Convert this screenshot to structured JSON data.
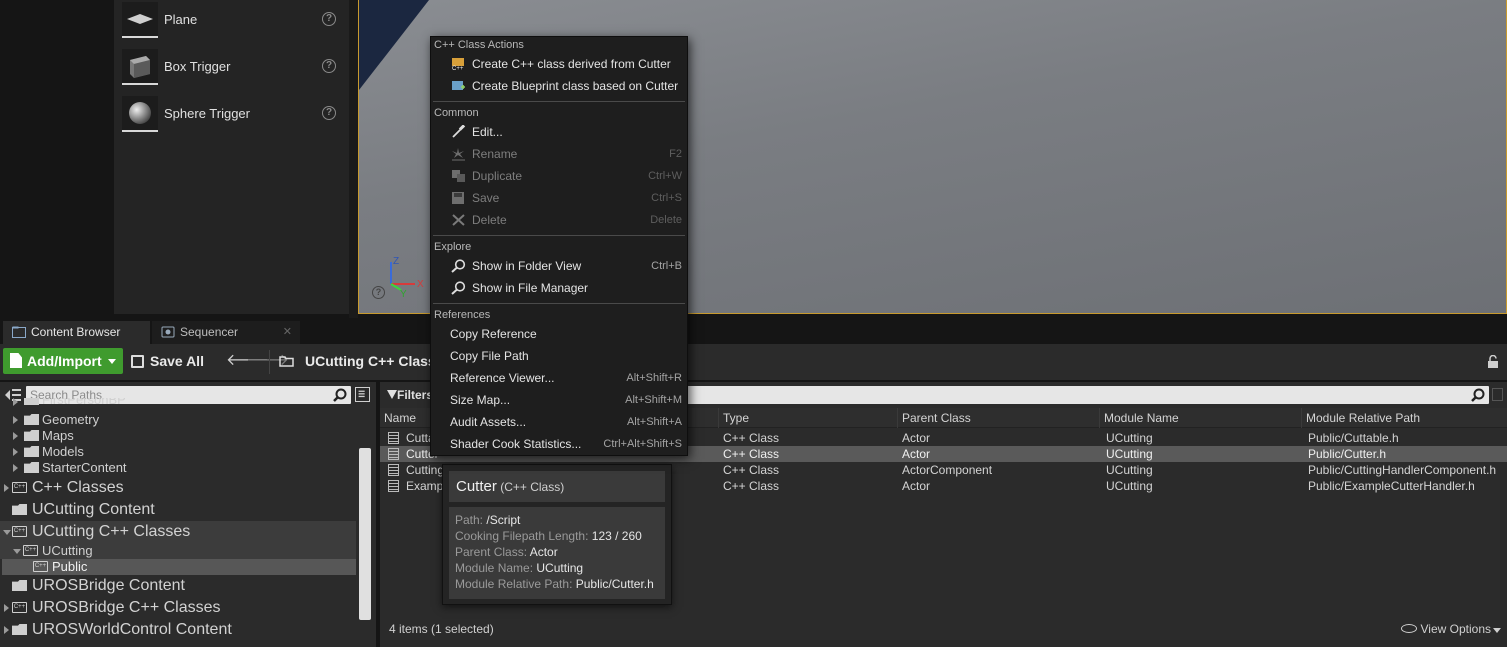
{
  "place_panel": {
    "items": [
      {
        "label": "Plane"
      },
      {
        "label": "Box Trigger"
      },
      {
        "label": "Sphere Trigger"
      }
    ],
    "help_glyph": "?"
  },
  "viewport": {
    "axis_labels": {
      "x": "X",
      "y": "Y",
      "z": "Z"
    },
    "help_glyph": "?"
  },
  "tabs": [
    {
      "label": "Content Browser",
      "active": true,
      "icon": "content-browser-icon"
    },
    {
      "label": "Sequencer",
      "active": false,
      "icon": "sequencer-icon"
    }
  ],
  "toolbar": {
    "add_import_label": "Add/Import",
    "save_all_label": "Save All",
    "path_label": "UCutting C++ Class"
  },
  "sources": {
    "search_placeholder": "Search Paths",
    "tree": [
      {
        "label": "FirstPersonBP",
        "kind": "folder",
        "level": 2,
        "size": "small"
      },
      {
        "label": "Geometry",
        "kind": "folder",
        "level": 2,
        "size": "small"
      },
      {
        "label": "Maps",
        "kind": "folder",
        "level": 2,
        "size": "small"
      },
      {
        "label": "Models",
        "kind": "folder",
        "level": 2,
        "size": "small"
      },
      {
        "label": "StarterContent",
        "kind": "folder",
        "level": 2,
        "size": "small"
      },
      {
        "label": "C++ Classes",
        "kind": "cpp",
        "level": 0,
        "size": "big"
      },
      {
        "label": "UCutting Content",
        "kind": "folder",
        "level": 0,
        "size": "big"
      },
      {
        "label": "UCutting C++ Classes",
        "kind": "cpp",
        "level": 0,
        "size": "big"
      },
      {
        "label": "UCutting",
        "kind": "cpp",
        "level": 1,
        "size": "small"
      },
      {
        "label": "Public",
        "kind": "cpp",
        "level": 2,
        "size": "small"
      },
      {
        "label": "UROSBridge Content",
        "kind": "folder",
        "level": 0,
        "size": "big"
      },
      {
        "label": "UROSBridge C++ Classes",
        "kind": "cpp",
        "level": 0,
        "size": "big"
      },
      {
        "label": "UROSWorldControl Content",
        "kind": "folder",
        "level": 0,
        "size": "big"
      }
    ]
  },
  "asset_view": {
    "filters_label": "Filters",
    "columns": [
      "Name",
      "Type",
      "Parent Class",
      "Module Name",
      "Module Relative Path"
    ],
    "rows": [
      {
        "name": "Cuttable",
        "type": "C++ Class",
        "parent": "Actor",
        "module": "UCutting",
        "path": "Public/Cuttable.h",
        "selected": false
      },
      {
        "name": "Cutter",
        "type": "C++ Class",
        "parent": "Actor",
        "module": "UCutting",
        "path": "Public/Cutter.h",
        "selected": true
      },
      {
        "name": "CuttingHandlerComponent",
        "type": "C++ Class",
        "parent": "ActorComponent",
        "module": "UCutting",
        "path": "Public/CuttingHandlerComponent.h",
        "selected": false
      },
      {
        "name": "ExampleCutterHandler",
        "type": "C++ Class",
        "parent": "Actor",
        "module": "UCutting",
        "path": "Public/ExampleCutterHandler.h",
        "selected": false
      }
    ],
    "item_count": "4 items (1 selected)",
    "view_options_label": "View Options"
  },
  "tooltip": {
    "title": "Cutter",
    "subtitle": "(C++ Class)",
    "lines": [
      {
        "key": "Path:",
        "value": "/Script"
      },
      {
        "key": "Cooking Filepath Length:",
        "value": "123 / 260"
      },
      {
        "key": "Parent Class:",
        "value": "Actor"
      },
      {
        "key": "Module Name:",
        "value": "UCutting"
      },
      {
        "key": "Module Relative Path:",
        "value": "Public/Cutter.h"
      }
    ]
  },
  "context_menu": {
    "sections": [
      {
        "heading": "C++ Class Actions",
        "items": [
          {
            "label": "Create C++ class derived from Cutter",
            "shortcut": "",
            "enabled": true,
            "icon": "cpp-class-icon"
          },
          {
            "label": "Create Blueprint class based on Cutter",
            "shortcut": "",
            "enabled": true,
            "icon": "blueprint-icon"
          }
        ]
      },
      {
        "heading": "Common",
        "items": [
          {
            "label": "Edit...",
            "shortcut": "",
            "enabled": true,
            "icon": "edit-icon"
          },
          {
            "label": "Rename",
            "shortcut": "F2",
            "enabled": false,
            "icon": "rename-icon"
          },
          {
            "label": "Duplicate",
            "shortcut": "Ctrl+W",
            "enabled": false,
            "icon": "duplicate-icon"
          },
          {
            "label": "Save",
            "shortcut": "Ctrl+S",
            "enabled": false,
            "icon": "save-icon"
          },
          {
            "label": "Delete",
            "shortcut": "Delete",
            "enabled": false,
            "icon": "delete-icon"
          }
        ]
      },
      {
        "heading": "Explore",
        "items": [
          {
            "label": "Show in Folder View",
            "shortcut": "Ctrl+B",
            "enabled": true,
            "icon": "magnifier-icon"
          },
          {
            "label": "Show in File Manager",
            "shortcut": "",
            "enabled": true,
            "icon": "magnifier-icon"
          }
        ]
      },
      {
        "heading": "References",
        "items": [
          {
            "label": "Copy Reference",
            "shortcut": "",
            "enabled": true,
            "icon": ""
          },
          {
            "label": "Copy File Path",
            "shortcut": "",
            "enabled": true,
            "icon": ""
          },
          {
            "label": "Reference Viewer...",
            "shortcut": "Alt+Shift+R",
            "enabled": true,
            "icon": ""
          },
          {
            "label": "Size Map...",
            "shortcut": "Alt+Shift+M",
            "enabled": true,
            "icon": ""
          },
          {
            "label": "Audit Assets...",
            "shortcut": "Alt+Shift+A",
            "enabled": true,
            "icon": ""
          },
          {
            "label": "Shader Cook Statistics...",
            "shortcut": "Ctrl+Alt+Shift+S",
            "enabled": true,
            "icon": ""
          }
        ]
      }
    ]
  },
  "colors": {
    "accent_green": "#3f9b2e",
    "viewport_border": "#c89a2e",
    "panel_bg": "#2b2b2b",
    "menu_bg": "#1e1e1e"
  }
}
